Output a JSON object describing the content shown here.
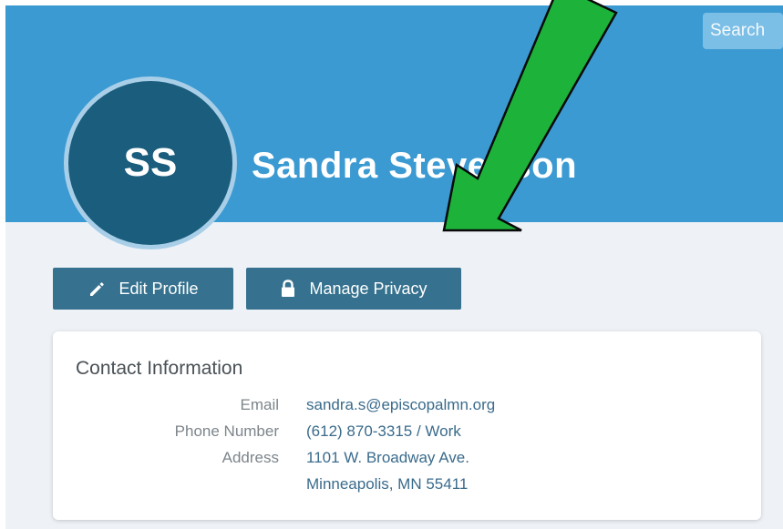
{
  "header": {
    "search_placeholder": "Search",
    "avatar_initials": "SS",
    "profile_name": "Sandra Stevenson"
  },
  "actions": {
    "edit_profile": {
      "label": "Edit Profile",
      "icon": "pencil-icon"
    },
    "manage_privacy": {
      "label": "Manage Privacy",
      "icon": "lock-icon"
    }
  },
  "contact": {
    "title": "Contact Information",
    "email_label": "Email",
    "email_value": "sandra.s@episcopalmn.org",
    "phone_label": "Phone Number",
    "phone_value": "(612) 870-3315 / Work",
    "address_label": "Address",
    "address_line1": "1101 W. Broadway Ave.",
    "address_line2": "Minneapolis, MN 55411"
  },
  "annotation": {
    "icon": "green-arrow-icon",
    "color": "#1db33a"
  },
  "colors": {
    "header": "#3b9ad2",
    "avatar": "#1a5d7d",
    "button": "#36728f",
    "link": "#3a6b8c"
  }
}
